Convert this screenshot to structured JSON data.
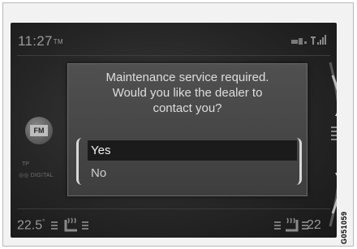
{
  "status": {
    "time": "11:27",
    "time_suffix": "TM"
  },
  "source": {
    "fm_label": "FM",
    "tp_label": "TP",
    "digital_label": "DIGITAL"
  },
  "climate": {
    "left_temp": "22.5",
    "left_degree": "°",
    "right_temp": "22"
  },
  "dialog": {
    "line1": "Maintenance service required.",
    "line2": "Would you like the dealer to",
    "line3": "contact you?",
    "options": [
      {
        "label": "Yes",
        "selected": true
      },
      {
        "label": "No",
        "selected": false
      }
    ]
  },
  "figure_code": "G051059",
  "colors": {
    "screen_bg": "#262626",
    "dialog_bg": "#484848",
    "selected_bg": "#1b1b1b",
    "text": "#dedede"
  }
}
